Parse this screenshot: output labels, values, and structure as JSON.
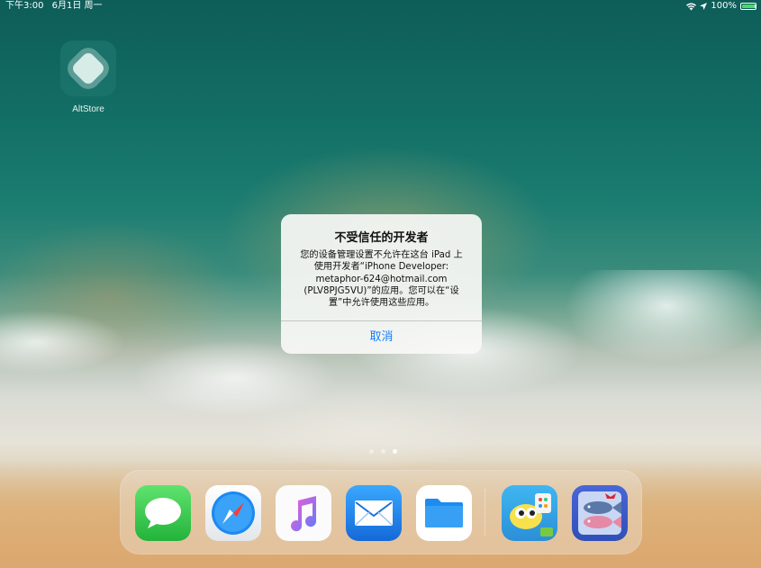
{
  "status_bar": {
    "time": "下午3:00",
    "date": "6月1日 周一",
    "battery": "100%",
    "wifi_icon": "wifi-icon",
    "location_icon": "location-icon",
    "battery_icon": "battery-icon"
  },
  "home": {
    "apps": [
      {
        "label": "AltStore",
        "icon": "altstore-icon"
      }
    ],
    "page_count": 3,
    "active_page": 3
  },
  "alert": {
    "title": "不受信任的开发者",
    "message": "您的设备管理设置不允许在这台 iPad 上\n使用开发者“iPhone Developer:\nmetaphor-624@hotmail.com\n(PLV8PJG5VU)”的应用。您可以在“设\n置”中允许使用这些应用。",
    "cancel_label": "取消"
  },
  "dock": {
    "apps": [
      {
        "icon": "messages-icon"
      },
      {
        "icon": "safari-icon"
      },
      {
        "icon": "music-icon"
      },
      {
        "icon": "mail-icon"
      },
      {
        "icon": "files-icon"
      },
      {
        "icon": "kids-app-icon"
      },
      {
        "icon": "fish-app-icon"
      }
    ]
  },
  "colors": {
    "accent_blue": "#157efb",
    "battery_green": "#4cd964",
    "messages_green": "#34c759"
  }
}
